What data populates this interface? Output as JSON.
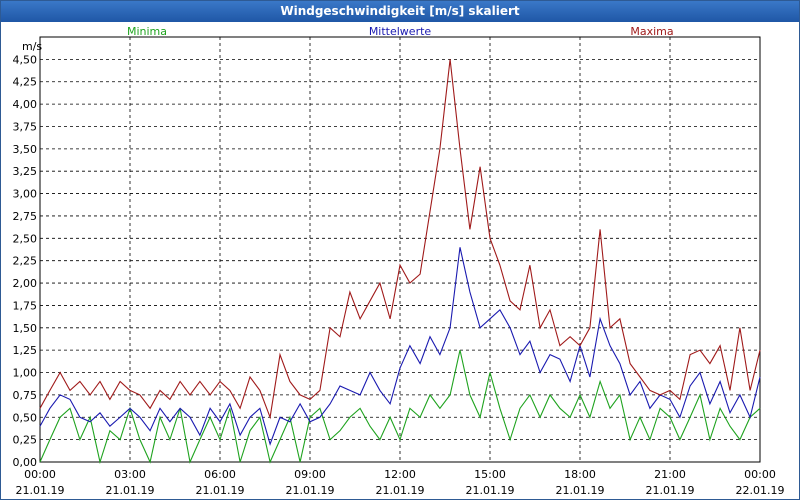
{
  "window": {
    "title": "Windgeschwindigkeit [m/s] skaliert"
  },
  "chart_data": {
    "type": "line",
    "title": "Windgeschwindigkeit [m/s] skaliert",
    "ylabel": "m/s",
    "ylim": [
      0,
      4.75
    ],
    "grid": true,
    "yticks": [
      "0,00",
      "0,25",
      "0,50",
      "0,75",
      "1,00",
      "1,25",
      "1,50",
      "1,75",
      "2,00",
      "2,25",
      "2,50",
      "2,75",
      "3,00",
      "3,25",
      "3,50",
      "3,75",
      "4,00",
      "4,25",
      "4,50"
    ],
    "xticks": [
      {
        "time": "00:00",
        "date": "21.01.19"
      },
      {
        "time": "03:00",
        "date": "21.01.19"
      },
      {
        "time": "06:00",
        "date": "21.01.19"
      },
      {
        "time": "09:00",
        "date": "21.01.19"
      },
      {
        "time": "12:00",
        "date": "21.01.19"
      },
      {
        "time": "15:00",
        "date": "21.01.19"
      },
      {
        "time": "18:00",
        "date": "21.01.19"
      },
      {
        "time": "21:00",
        "date": "21.01.19"
      },
      {
        "time": "00:00",
        "date": "22.01.19"
      }
    ],
    "xlim_hours": [
      0,
      24
    ],
    "series": [
      {
        "name": "Minima",
        "color": "#1fa31f",
        "x": [
          0,
          0.33,
          0.67,
          1,
          1.33,
          1.67,
          2,
          2.33,
          2.67,
          3,
          3.33,
          3.67,
          4,
          4.33,
          4.67,
          5,
          5.33,
          5.67,
          6,
          6.33,
          6.67,
          7,
          7.33,
          7.67,
          8,
          8.33,
          8.67,
          9,
          9.33,
          9.67,
          10,
          10.33,
          10.67,
          11,
          11.33,
          11.67,
          12,
          12.33,
          12.67,
          13,
          13.33,
          13.67,
          14,
          14.33,
          14.67,
          15,
          15.33,
          15.67,
          16,
          16.33,
          16.67,
          17,
          17.33,
          17.67,
          18,
          18.33,
          18.67,
          19,
          19.33,
          19.67,
          20,
          20.33,
          20.67,
          21,
          21.33,
          21.67,
          22,
          22.33,
          22.67,
          23,
          23.33,
          23.67,
          24
        ],
        "values": [
          0,
          0.25,
          0.5,
          0.6,
          0.25,
          0.5,
          0,
          0.35,
          0.25,
          0.6,
          0.25,
          0,
          0.5,
          0.25,
          0.6,
          0,
          0.25,
          0.5,
          0.25,
          0.6,
          0,
          0.35,
          0.5,
          0,
          0.25,
          0.5,
          0,
          0.5,
          0.6,
          0.25,
          0.35,
          0.5,
          0.6,
          0.4,
          0.25,
          0.5,
          0.25,
          0.6,
          0.5,
          0.75,
          0.6,
          0.75,
          1.25,
          0.75,
          0.5,
          1,
          0.6,
          0.25,
          0.6,
          0.75,
          0.5,
          0.75,
          0.6,
          0.5,
          0.75,
          0.5,
          0.9,
          0.6,
          0.75,
          0.25,
          0.5,
          0.25,
          0.6,
          0.5,
          0.25,
          0.5,
          0.75,
          0.25,
          0.6,
          0.4,
          0.25,
          0.5,
          0.6
        ]
      },
      {
        "name": "Mittelwerte",
        "color": "#1a1ab0",
        "x": [
          0,
          0.33,
          0.67,
          1,
          1.33,
          1.67,
          2,
          2.33,
          2.67,
          3,
          3.33,
          3.67,
          4,
          4.33,
          4.67,
          5,
          5.33,
          5.67,
          6,
          6.33,
          6.67,
          7,
          7.33,
          7.67,
          8,
          8.33,
          8.67,
          9,
          9.33,
          9.67,
          10,
          10.33,
          10.67,
          11,
          11.33,
          11.67,
          12,
          12.33,
          12.67,
          13,
          13.33,
          13.67,
          14,
          14.33,
          14.67,
          15,
          15.33,
          15.67,
          16,
          16.33,
          16.67,
          17,
          17.33,
          17.67,
          18,
          18.33,
          18.67,
          19,
          19.33,
          19.67,
          20,
          20.33,
          20.67,
          21,
          21.33,
          21.67,
          22,
          22.33,
          22.67,
          23,
          23.33,
          23.67,
          24
        ],
        "values": [
          0.4,
          0.6,
          0.75,
          0.7,
          0.5,
          0.45,
          0.55,
          0.4,
          0.5,
          0.6,
          0.5,
          0.35,
          0.6,
          0.45,
          0.6,
          0.5,
          0.3,
          0.6,
          0.45,
          0.65,
          0.3,
          0.5,
          0.6,
          0.2,
          0.5,
          0.45,
          0.65,
          0.45,
          0.5,
          0.65,
          0.85,
          0.8,
          0.75,
          1,
          0.8,
          0.65,
          1.05,
          1.3,
          1.1,
          1.4,
          1.2,
          1.5,
          2.4,
          1.9,
          1.5,
          1.6,
          1.7,
          1.5,
          1.2,
          1.35,
          1,
          1.2,
          1.15,
          0.9,
          1.3,
          0.95,
          1.6,
          1.3,
          1.1,
          0.75,
          0.9,
          0.6,
          0.75,
          0.7,
          0.5,
          0.85,
          1,
          0.65,
          0.9,
          0.55,
          0.75,
          0.5,
          0.95
        ]
      },
      {
        "name": "Maxima",
        "color": "#a01a1a",
        "x": [
          0,
          0.33,
          0.67,
          1,
          1.33,
          1.67,
          2,
          2.33,
          2.67,
          3,
          3.33,
          3.67,
          4,
          4.33,
          4.67,
          5,
          5.33,
          5.67,
          6,
          6.33,
          6.67,
          7,
          7.33,
          7.67,
          8,
          8.33,
          8.67,
          9,
          9.33,
          9.67,
          10,
          10.33,
          10.67,
          11,
          11.33,
          11.67,
          12,
          12.33,
          12.67,
          13,
          13.33,
          13.67,
          14,
          14.33,
          14.67,
          15,
          15.33,
          15.67,
          16,
          16.33,
          16.67,
          17,
          17.33,
          17.67,
          18,
          18.33,
          18.67,
          19,
          19.33,
          19.67,
          20,
          20.33,
          20.67,
          21,
          21.33,
          21.67,
          22,
          22.33,
          22.67,
          23,
          23.33,
          23.67,
          24
        ],
        "values": [
          0.6,
          0.8,
          1,
          0.8,
          0.9,
          0.75,
          0.9,
          0.7,
          0.9,
          0.8,
          0.75,
          0.6,
          0.8,
          0.7,
          0.9,
          0.75,
          0.9,
          0.75,
          0.9,
          0.8,
          0.6,
          0.95,
          0.8,
          0.5,
          1.2,
          0.9,
          0.75,
          0.7,
          0.8,
          1.5,
          1.4,
          1.9,
          1.6,
          1.8,
          2.0,
          1.6,
          2.2,
          2.0,
          2.1,
          2.8,
          3.5,
          4.5,
          3.5,
          2.6,
          3.3,
          2.5,
          2.2,
          1.8,
          1.7,
          2.2,
          1.5,
          1.7,
          1.3,
          1.4,
          1.3,
          1.5,
          2.6,
          1.5,
          1.6,
          1.1,
          0.95,
          0.8,
          0.75,
          0.8,
          0.7,
          1.2,
          1.25,
          1.1,
          1.3,
          0.8,
          1.5,
          0.8,
          1.25
        ]
      }
    ]
  }
}
